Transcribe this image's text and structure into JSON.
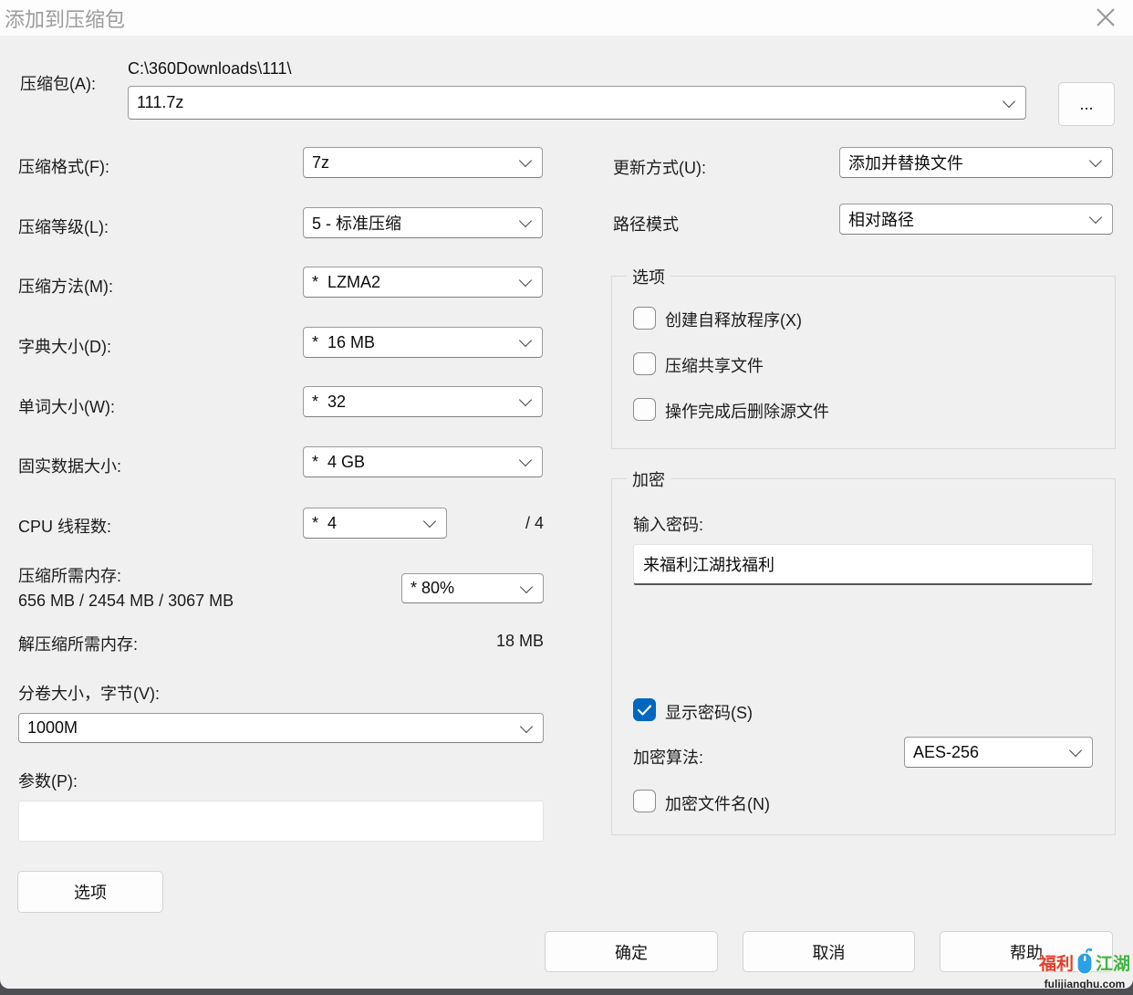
{
  "window": {
    "title": "添加到压缩包"
  },
  "archive": {
    "label": "压缩包(A):",
    "dir_path": "C:\\360Downloads\\111\\",
    "name_value": "111.7z",
    "browse_label": "..."
  },
  "left": {
    "format": {
      "label": "压缩格式(F):",
      "value": "7z"
    },
    "level": {
      "label": "压缩等级(L):",
      "value": "5 - 标准压缩"
    },
    "method": {
      "label": "压缩方法(M):",
      "value": "*  LZMA2"
    },
    "dict": {
      "label": "字典大小(D):",
      "value": "*  16 MB"
    },
    "word": {
      "label": "单词大小(W):",
      "value": "*  32"
    },
    "solid": {
      "label": "固实数据大小:",
      "value": "*  4 GB"
    },
    "threads": {
      "label": "CPU 线程数:",
      "value": "*  4",
      "max": "/ 4"
    },
    "mem_compress": {
      "label": "压缩所需内存:",
      "value": "656 MB / 2454 MB / 3067 MB",
      "percent": "* 80%"
    },
    "mem_decompress": {
      "label": "解压缩所需内存:",
      "value": "18 MB"
    },
    "volume": {
      "label": "分卷大小，字节(V):",
      "value": "1000M"
    },
    "params": {
      "label": "参数(P):",
      "value": ""
    },
    "options_button": "选项"
  },
  "right": {
    "update_mode": {
      "label": "更新方式(U):",
      "value": "添加并替换文件"
    },
    "path_mode": {
      "label": "路径模式",
      "value": "相对路径"
    },
    "options_group": {
      "legend": "选项",
      "checkboxes": [
        {
          "label": "创建自释放程序(X)",
          "checked": false
        },
        {
          "label": "压缩共享文件",
          "checked": false
        },
        {
          "label": "操作完成后删除源文件",
          "checked": false
        }
      ]
    },
    "encryption_group": {
      "legend": "加密",
      "password_label": "输入密码:",
      "password_value": "来福利江湖找福利",
      "show_password": {
        "label": "显示密码(S)",
        "checked": true
      },
      "algorithm": {
        "label": "加密算法:",
        "value": "AES-256"
      },
      "encrypt_names": {
        "label": "加密文件名(N)",
        "checked": false
      }
    }
  },
  "footer": {
    "ok": "确定",
    "cancel": "取消",
    "help": "帮助"
  },
  "watermark": {
    "part1": "福利",
    "part2": "江湖",
    "url": "fulijianghu.com"
  },
  "colors": {
    "accent_checkbox": "#0067c0",
    "watermark_red": "#e23d33",
    "watermark_green": "#3cb54a",
    "watermark_blue": "#2ba0e8",
    "dialog_bg": "#f0f0f0",
    "titlebar_bg": "#fdfdfd",
    "inactive_title": "#9c9c9c"
  }
}
